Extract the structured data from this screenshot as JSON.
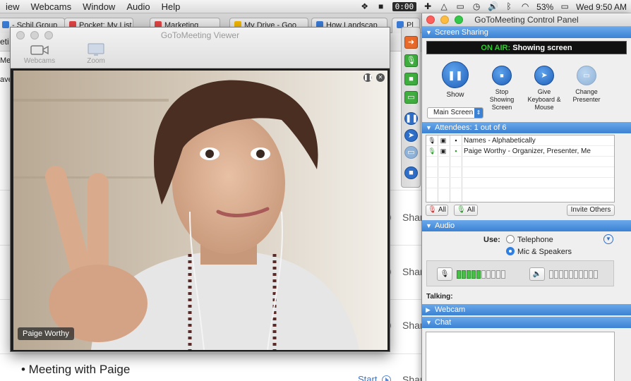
{
  "menubar": {
    "items": [
      "iew",
      "Webcams",
      "Window",
      "Audio",
      "Help"
    ],
    "timer": "0:00",
    "battery": "53%",
    "clock": "Wed 9:50 AM"
  },
  "browser": {
    "tabs": [
      {
        "label": "- Schil Group",
        "color": "#3a7bd5"
      },
      {
        "label": "Pocket: My List",
        "color": "#e24444"
      },
      {
        "label": "Marketing",
        "color": "#e24444"
      },
      {
        "label": "My Drive - Goo",
        "color": "#f2b600"
      },
      {
        "label": "How Landscap",
        "color": "#3a7bd5"
      },
      {
        "label": "Pl",
        "color": "#3a7bd5"
      }
    ],
    "edge_fragments": [
      "eti",
      "Me",
      "ave"
    ],
    "share_label": "Shar",
    "meeting_item": "• Meeting with Paige",
    "start_link": "Start"
  },
  "viewer": {
    "title": "GoToMeeting Viewer",
    "webcams_label": "Webcams",
    "zoom_label": "Zoom",
    "presenter_name": "Paige Worthy"
  },
  "panel": {
    "title": "GoToMeeting Control Panel",
    "screen_sharing": {
      "header": "Screen Sharing",
      "status_prefix": "ON AIR:",
      "status_text": " Showing screen",
      "show_label": "Show",
      "screen_select": "Main Screen",
      "stop_label": "Stop Showing Screen",
      "give_label": "Give Keyboard & Mouse",
      "change_label": "Change Presenter"
    },
    "attendees": {
      "header": "Attendees: 1 out of 6",
      "rows": [
        {
          "text": "Names - Alphabetically"
        },
        {
          "text": "Paige Worthy - Organizer, Presenter, Me"
        }
      ],
      "mute_all": "All",
      "unmute_all": "All",
      "invite": "Invite Others"
    },
    "audio": {
      "header": "Audio",
      "use_label": "Use:",
      "option_telephone": "Telephone",
      "option_mic": "Mic & Speakers",
      "mic_level": 0.5,
      "speaker_level": 0,
      "talking_label": "Talking:"
    },
    "webcam_header": "Webcam",
    "chat_header": "Chat"
  }
}
